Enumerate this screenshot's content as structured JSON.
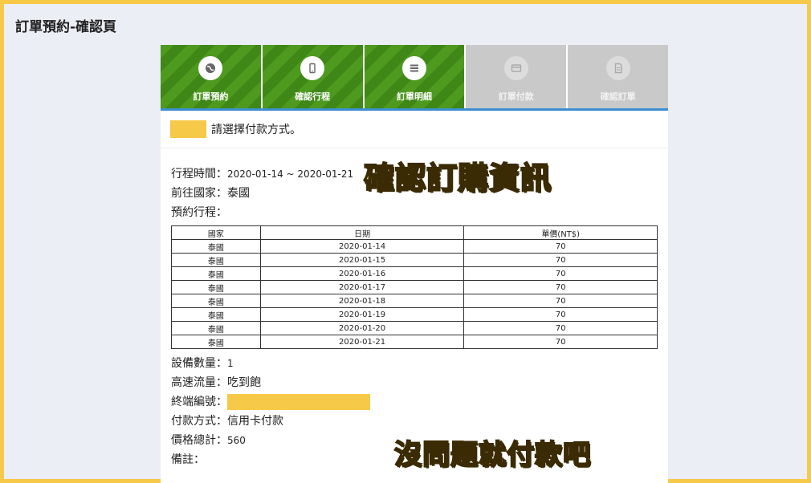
{
  "page_title": "訂單預約-確認頁",
  "steps": [
    {
      "label": "訂單預約",
      "icon": "globe-icon",
      "state": "active"
    },
    {
      "label": "確認行程",
      "icon": "phone-icon",
      "state": "active"
    },
    {
      "label": "訂單明細",
      "icon": "list-icon",
      "state": "active"
    },
    {
      "label": "訂單付款",
      "icon": "card-icon",
      "state": "inactive"
    },
    {
      "label": "確認訂單",
      "icon": "document-icon",
      "state": "inactive"
    }
  ],
  "notice_text": "請選擇付款方式。",
  "trip": {
    "time_label": "行程時間：",
    "time_value": "2020-01-14 ~ 2020-01-21",
    "country_label": "前往國家：",
    "country_value": "泰國",
    "schedule_label": "預約行程："
  },
  "table": {
    "headers": [
      "國家",
      "日期",
      "單價(NT$)"
    ],
    "rows": [
      [
        "泰國",
        "2020-01-14",
        "70"
      ],
      [
        "泰國",
        "2020-01-15",
        "70"
      ],
      [
        "泰國",
        "2020-01-16",
        "70"
      ],
      [
        "泰國",
        "2020-01-17",
        "70"
      ],
      [
        "泰國",
        "2020-01-18",
        "70"
      ],
      [
        "泰國",
        "2020-01-19",
        "70"
      ],
      [
        "泰國",
        "2020-01-20",
        "70"
      ],
      [
        "泰國",
        "2020-01-21",
        "70"
      ]
    ]
  },
  "details": {
    "device_count_label": "設備數量：",
    "device_count_value": "1",
    "traffic_label": "高速流量：",
    "traffic_value": "吃到飽",
    "terminal_label": "終端編號：",
    "payment_label": "付款方式：",
    "payment_value": "信用卡付款",
    "total_label": "價格總計：",
    "total_value": "560",
    "remark_label": "備註："
  },
  "overlays": {
    "confirm_caption": "確認訂購資訊",
    "pay_caption": "沒問題就付款吧"
  },
  "colors": {
    "frame": "#f7c948",
    "active_step": "#4e9a1f",
    "inactive_step": "#c9c9c9",
    "step_underline": "#3d8fd1"
  }
}
